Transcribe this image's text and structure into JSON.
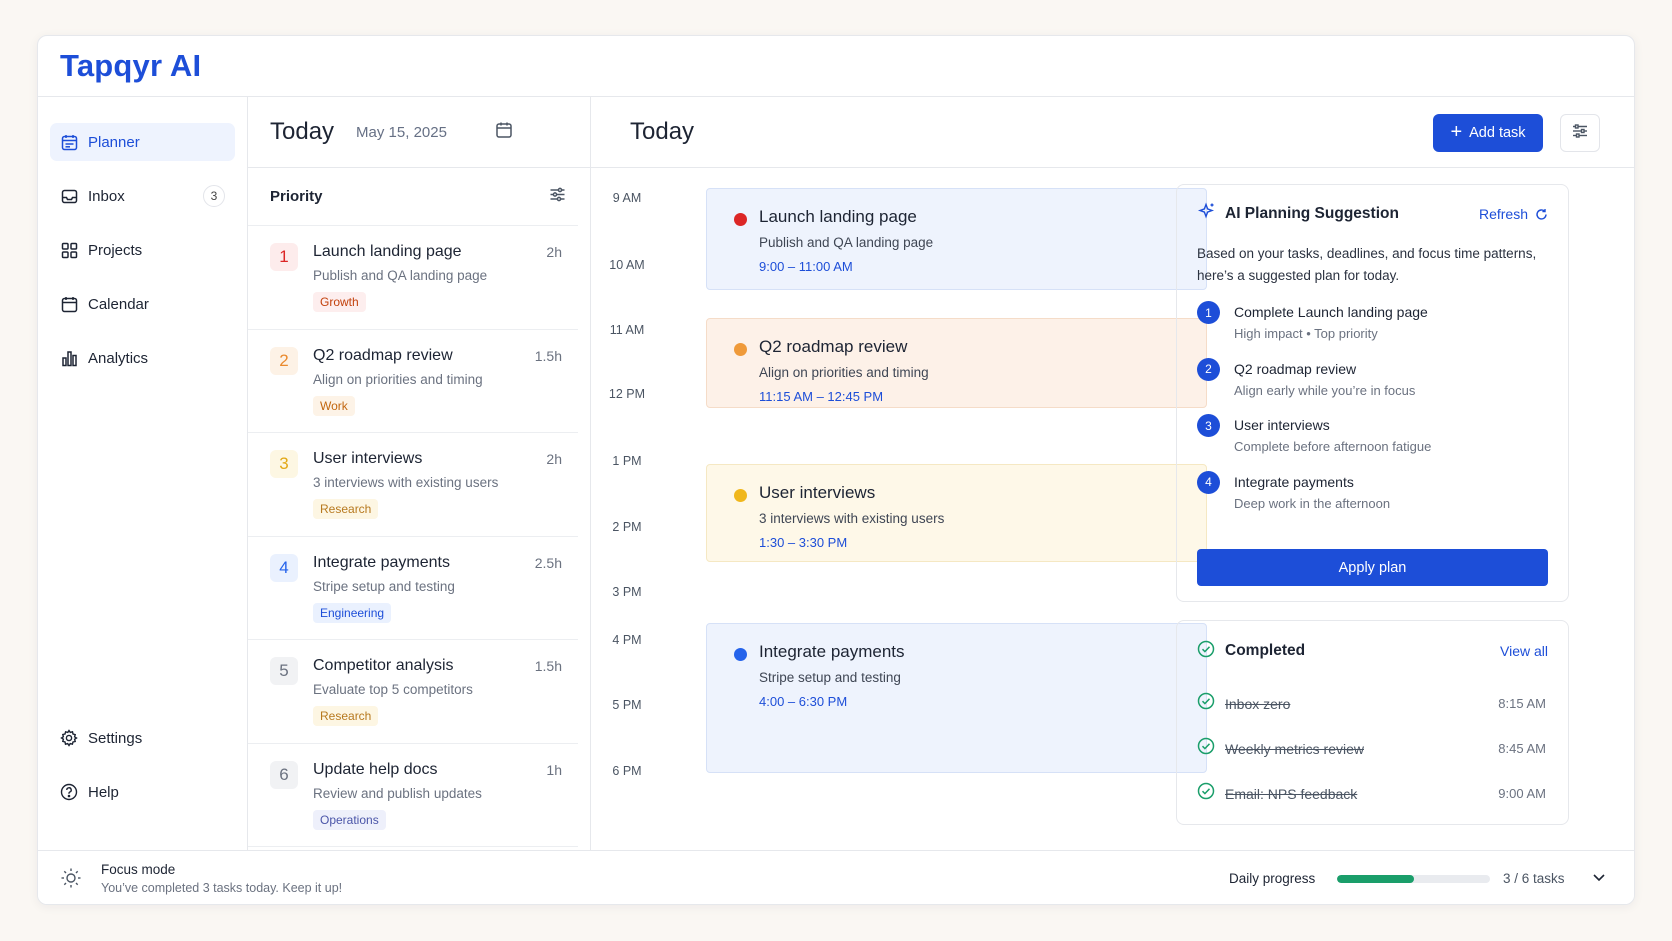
{
  "app": {
    "title": "Tapqyr AI"
  },
  "sidebar": {
    "items": [
      {
        "label": "Planner",
        "icon": "planner-icon",
        "active": true
      },
      {
        "label": "Inbox",
        "icon": "inbox-icon",
        "badge": "3"
      },
      {
        "label": "Projects",
        "icon": "projects-icon"
      },
      {
        "label": "Calendar",
        "icon": "calendar-icon"
      },
      {
        "label": "Analytics",
        "icon": "analytics-icon"
      }
    ],
    "bottom": [
      {
        "label": "Settings",
        "icon": "gear-icon"
      },
      {
        "label": "Help",
        "icon": "help-icon"
      }
    ]
  },
  "left": {
    "title": "Today",
    "date": "May 15, 2025",
    "priority_label": "Priority",
    "tasks": [
      {
        "num": "1",
        "title": "Launch landing page",
        "duration": "2h",
        "subtitle": "Publish and QA landing page",
        "tag": "Growth",
        "num_color": "#dc2626",
        "num_bg": "#fdecec",
        "tag_color": "#c2410c",
        "tag_bg": "#fdeeee"
      },
      {
        "num": "2",
        "title": "Q2 roadmap review",
        "duration": "1.5h",
        "subtitle": "Align on priorities and timing",
        "tag": "Work",
        "num_color": "#ea8a2e",
        "num_bg": "#fdf2e6",
        "tag_color": "#c2660f",
        "tag_bg": "#fdf3e7"
      },
      {
        "num": "3",
        "title": "User interviews",
        "duration": "2h",
        "subtitle": "3 interviews with existing users",
        "tag": "Research",
        "num_color": "#e2a816",
        "num_bg": "#fdf7e3",
        "tag_color": "#b7791f",
        "tag_bg": "#fdf6e3"
      },
      {
        "num": "4",
        "title": "Integrate payments",
        "duration": "2.5h",
        "subtitle": "Stripe setup and testing",
        "tag": "Engineering",
        "num_color": "#2563eb",
        "num_bg": "#eaf1fe",
        "tag_color": "#1d4ed8",
        "tag_bg": "#eaf1fe"
      },
      {
        "num": "5",
        "title": "Competitor analysis",
        "duration": "1.5h",
        "subtitle": "Evaluate top 5 competitors",
        "tag": "Research",
        "num_color": "#6b7280",
        "num_bg": "#f1f2f4",
        "tag_color": "#b7791f",
        "tag_bg": "#fdf6e3"
      },
      {
        "num": "6",
        "title": "Update help docs",
        "duration": "1h",
        "subtitle": "Review and publish updates",
        "tag": "Operations",
        "num_color": "#6b7280",
        "num_bg": "#f1f2f4",
        "tag_color": "#4b55a8",
        "tag_bg": "#eef0fb"
      }
    ]
  },
  "main": {
    "title": "Today",
    "add_task_label": "Add task",
    "hours": [
      "9 AM",
      "10 AM",
      "11 AM",
      "12 PM",
      "1 PM",
      "2 PM",
      "3 PM",
      "4 PM",
      "5 PM",
      "6 PM"
    ],
    "events": [
      {
        "title": "Launch landing page",
        "subtitle": "Publish and QA landing page",
        "time": "9:00 – 11:00 AM",
        "dot": "#dc2626",
        "bg": "#eef3fd",
        "border": "#d6e1f7"
      },
      {
        "title": "Q2 roadmap review",
        "subtitle": "Align on priorities and timing",
        "time": "11:15 AM – 12:45 PM",
        "dot": "#ef9a3a",
        "bg": "#fdf1e8",
        "border": "#f5dcc8"
      },
      {
        "title": "User interviews",
        "subtitle": "3 interviews with existing users",
        "time": "1:30 – 3:30 PM",
        "dot": "#f0b71c",
        "bg": "#fef8e8",
        "border": "#f5e8c3"
      },
      {
        "title": "Integrate payments",
        "subtitle": "Stripe setup and testing",
        "time": "4:00 – 6:30 PM",
        "dot": "#2563eb",
        "bg": "#eef3fd",
        "border": "#d6e1f7"
      }
    ]
  },
  "ai": {
    "title": "AI Planning Suggestion",
    "refresh_label": "Refresh",
    "description": "Based on your tasks, deadlines, and focus time patterns, here’s a suggested plan for today.",
    "steps": [
      {
        "num": "1",
        "title": "Complete Launch landing page",
        "subtitle": "High impact • Top priority"
      },
      {
        "num": "2",
        "title": "Q2 roadmap review",
        "subtitle": "Align early while you’re in focus"
      },
      {
        "num": "3",
        "title": "User interviews",
        "subtitle": "Complete before afternoon fatigue"
      },
      {
        "num": "4",
        "title": "Integrate payments",
        "subtitle": "Deep work in the afternoon"
      }
    ],
    "apply_label": "Apply plan"
  },
  "completed": {
    "title": "Completed",
    "view_all_label": "View all",
    "items": [
      {
        "title": "Inbox zero",
        "time": "8:15 AM"
      },
      {
        "title": "Weekly metrics review",
        "time": "8:45 AM"
      },
      {
        "title": "Email: NPS feedback",
        "time": "9:00 AM"
      }
    ]
  },
  "footer": {
    "focus_title": "Focus mode",
    "focus_subtitle": "You’ve completed 3 tasks today. Keep it up!",
    "progress_label": "Daily progress",
    "progress_fraction": 0.5,
    "progress_count": "3 / 6 tasks"
  },
  "colors": {
    "accent": "#1d4ed8",
    "progress": "#1a9e6a"
  }
}
